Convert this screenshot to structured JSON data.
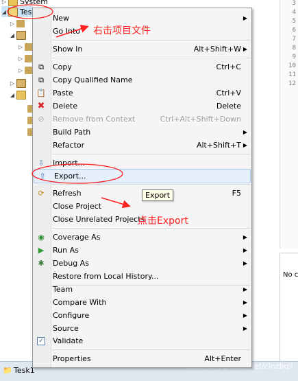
{
  "tree": {
    "top_label": "System",
    "project_label": "Tes"
  },
  "editor_lines": [
    "3",
    "4",
    "5",
    "6",
    "7",
    "8",
    "9",
    "10",
    "11",
    "12"
  ],
  "menu": {
    "items": [
      {
        "label": "New",
        "shortcut": "",
        "submenu": true
      },
      {
        "label": "Go Into",
        "shortcut": "",
        "submenu": false
      },
      {
        "label": "Show In",
        "shortcut": "Alt+Shift+W",
        "submenu": true
      },
      {
        "label": "Copy",
        "shortcut": "Ctrl+C",
        "submenu": false
      },
      {
        "label": "Copy Qualified Name",
        "shortcut": "",
        "submenu": false
      },
      {
        "label": "Paste",
        "shortcut": "Ctrl+V",
        "submenu": false
      },
      {
        "label": "Delete",
        "shortcut": "Delete",
        "submenu": false
      },
      {
        "label": "Remove from Context",
        "shortcut": "Ctrl+Alt+Shift+Down",
        "submenu": false
      },
      {
        "label": "Build Path",
        "shortcut": "",
        "submenu": true
      },
      {
        "label": "Refactor",
        "shortcut": "Alt+Shift+T",
        "submenu": true
      },
      {
        "label": "Import...",
        "shortcut": "",
        "submenu": false
      },
      {
        "label": "Export...",
        "shortcut": "",
        "submenu": false
      },
      {
        "label": "Refresh",
        "shortcut": "F5",
        "submenu": false
      },
      {
        "label": "Close Project",
        "shortcut": "",
        "submenu": false
      },
      {
        "label": "Close Unrelated Projects",
        "shortcut": "",
        "submenu": false
      },
      {
        "label": "Coverage As",
        "shortcut": "",
        "submenu": true
      },
      {
        "label": "Run As",
        "shortcut": "",
        "submenu": true
      },
      {
        "label": "Debug As",
        "shortcut": "",
        "submenu": true
      },
      {
        "label": "Restore from Local History...",
        "shortcut": "",
        "submenu": false
      },
      {
        "label": "Team",
        "shortcut": "",
        "submenu": true
      },
      {
        "label": "Compare With",
        "shortcut": "",
        "submenu": true
      },
      {
        "label": "Configure",
        "shortcut": "",
        "submenu": true
      },
      {
        "label": "Source",
        "shortcut": "",
        "submenu": true
      },
      {
        "label": "Validate",
        "shortcut": "",
        "submenu": false
      },
      {
        "label": "Properties",
        "shortcut": "Alt+Enter",
        "submenu": false
      }
    ]
  },
  "tooltip": "Export",
  "annotations": {
    "right_click": "右击项目文件",
    "click_export": "点击Export"
  },
  "panel2": {
    "label": "No c"
  },
  "taskbar": {
    "label": "Tesk1"
  },
  "watermark": "https://blog.csdn.net/clnzbqll",
  "colors": {
    "annotation": "#ff2020",
    "highlight": "#e6f0fb"
  }
}
